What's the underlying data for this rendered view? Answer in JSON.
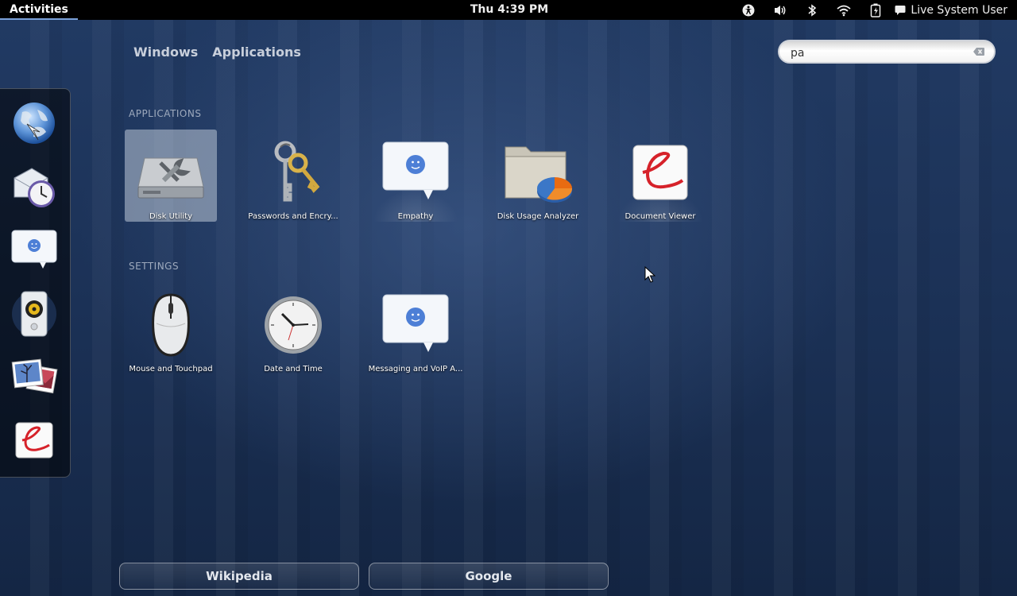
{
  "topbar": {
    "activities": "Activities",
    "clock": "Thu  4:39 PM",
    "user": "Live System User",
    "tray_icons": [
      "accessibility-icon",
      "volume-icon",
      "bluetooth-icon",
      "wifi-icon",
      "battery-icon"
    ]
  },
  "view_tabs": [
    "Windows",
    "Applications"
  ],
  "search": {
    "value": "pa"
  },
  "dash": {
    "items": [
      "web-browser-icon",
      "evolution-mail-icon",
      "empathy-icon",
      "rhythmbox-icon",
      "shotwell-icon",
      "document-viewer-icon"
    ]
  },
  "applications": {
    "heading": "APPLICATIONS",
    "items": [
      {
        "label": "Disk Utility",
        "icon": "disk-utility-icon",
        "selected": true
      },
      {
        "label": "Passwords and Encry...",
        "icon": "keys-icon"
      },
      {
        "label": "Empathy",
        "icon": "chat-bubble-icon"
      },
      {
        "label": "Disk Usage Analyzer",
        "icon": "disk-usage-icon"
      },
      {
        "label": "Document Viewer",
        "icon": "document-viewer-icon"
      }
    ]
  },
  "settings": {
    "heading": "SETTINGS",
    "items": [
      {
        "label": "Mouse and Touchpad",
        "icon": "mouse-icon"
      },
      {
        "label": "Date and Time",
        "icon": "clock-icon"
      },
      {
        "label": "Messaging and VoIP A...",
        "icon": "chat-bubble-icon"
      }
    ]
  },
  "search_providers": [
    "Wikipedia",
    "Google"
  ]
}
